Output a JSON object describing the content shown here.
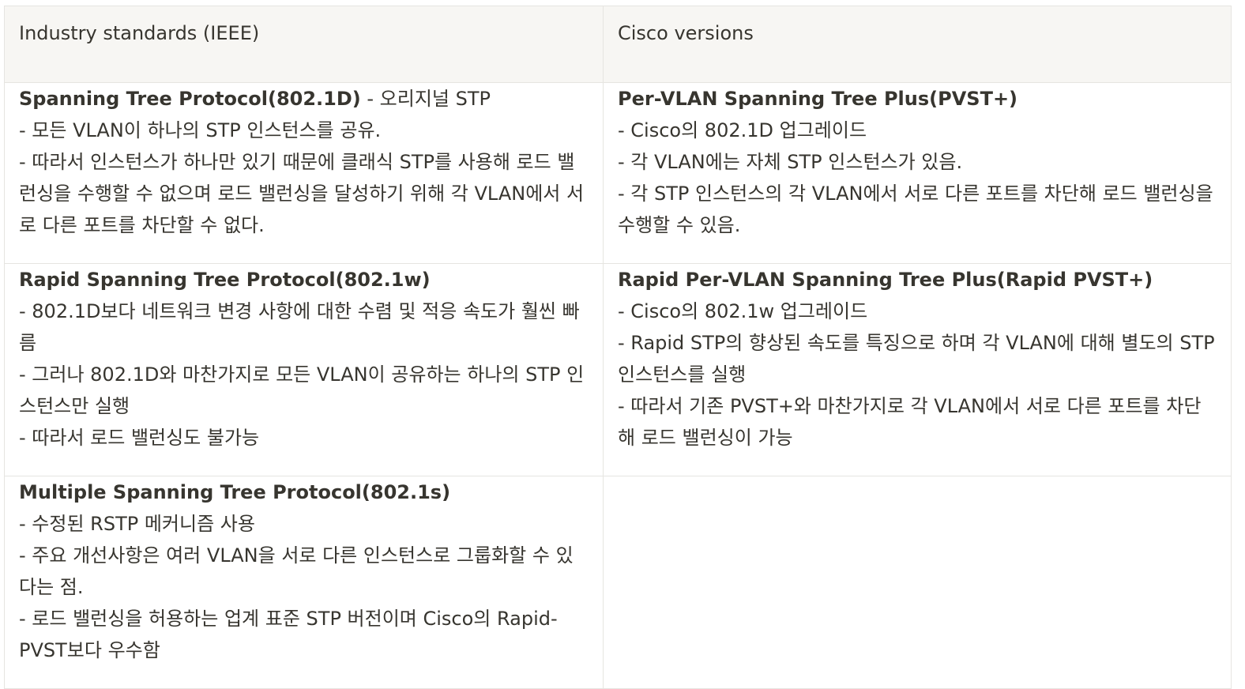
{
  "table": {
    "headers": {
      "ieee": "Industry standards (IEEE)",
      "cisco": "Cisco versions"
    },
    "rows": [
      {
        "ieee": {
          "title": "Spanning Tree Protocol(802.1D)",
          "title_suffix": " - 오리지널 STP",
          "lines": [
            "- 모든 VLAN이 하나의 STP 인스턴스를 공유.",
            "- 따라서 인스턴스가 하나만 있기 때문에 클래식 STP를 사용해 로드 밸런싱을 수행할 수 없으며 로드 밸런싱을 달성하기 위해 각 VLAN에서 서로 다른 포트를 차단할 수 없다."
          ]
        },
        "cisco": {
          "title": "Per-VLAN Spanning Tree Plus(PVST+)",
          "lines": [
            "- Cisco의 802.1D 업그레이드",
            "- 각 VLAN에는 자체 STP 인스턴스가 있음.",
            "- 각 STP 인스턴스의 각 VLAN에서 서로 다른 포트를 차단해 로드 밸런싱을 수행할 수 있음."
          ]
        }
      },
      {
        "ieee": {
          "title": "Rapid Spanning Tree Protocol(802.1w)",
          "lines": [
            "- 802.1D보다 네트워크 변경 사항에 대한 수렴 및 적응 속도가 훨씬 빠름",
            "- 그러나 802.1D와 마찬가지로 모든 VLAN이 공유하는 하나의 STP 인스턴스만 실행",
            "- 따라서 로드 밸런싱도 불가능"
          ]
        },
        "cisco": {
          "title": "Rapid Per-VLAN Spanning Tree Plus(Rapid PVST+)",
          "lines": [
            "- Cisco의 802.1w 업그레이드",
            "- Rapid STP의 향상된 속도를 특징으로 하며 각 VLAN에 대해 별도의 STP 인스턴스를 실행",
            "- 따라서 기존 PVST+와 마찬가지로 각 VLAN에서 서로 다른 포트를 차단해 로드 밸런싱이 가능"
          ]
        }
      },
      {
        "ieee": {
          "title": "Multiple Spanning Tree Protocol(802.1s)",
          "lines": [
            "- 수정된 RSTP 메커니즘 사용",
            "- 주요 개선사항은 여러 VLAN을 서로 다른 인스턴스로 그룹화할 수 있다는 점.",
            "- 로드 밸런싱을 허용하는 업계 표준 STP 버전이며 Cisco의 Rapid-PVST보다 우수함"
          ]
        }
      }
    ]
  }
}
